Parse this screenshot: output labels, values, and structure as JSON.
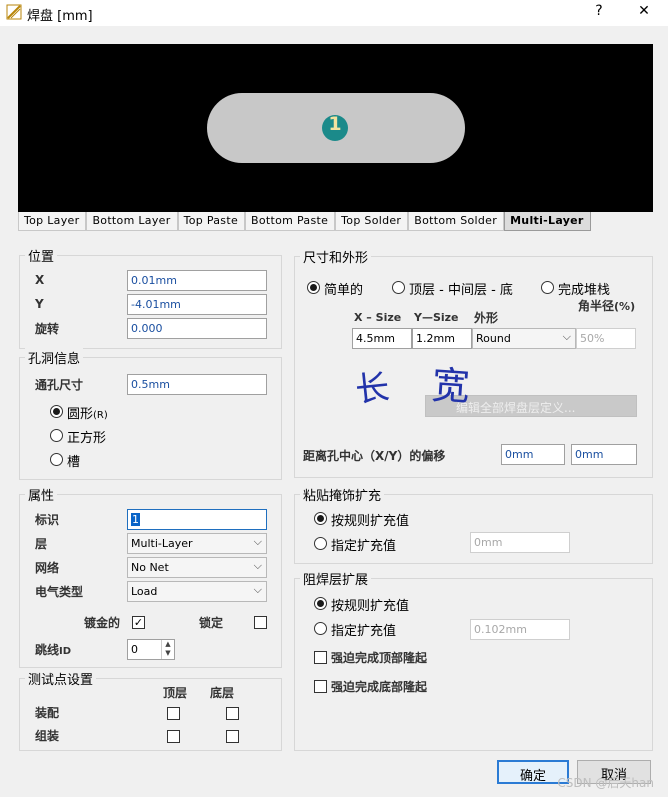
{
  "window": {
    "title": "焊盘 [mm]",
    "help": "?",
    "close": "✕"
  },
  "preview": {
    "pad_number": "1"
  },
  "tabs": [
    "Top Layer",
    "Bottom Layer",
    "Top Paste",
    "Bottom Paste",
    "Top Solder",
    "Bottom Solder",
    "Multi-Layer"
  ],
  "location": {
    "title": "位置",
    "x_label": "X",
    "x_value": "0.01mm",
    "y_label": "Y",
    "y_value": "-4.01mm",
    "rot_label": "旋转",
    "rot_value": "0.000"
  },
  "hole": {
    "title": "孔洞信息",
    "size_label": "通孔尺寸",
    "size_value": "0.5mm",
    "round": "圆形",
    "round_suffix": "(R)",
    "square": "正方形",
    "slot": "槽"
  },
  "properties": {
    "title": "属性",
    "designator_label": "标识",
    "designator_value": "1",
    "layer_label": "层",
    "layer_value": "Multi-Layer",
    "net_label": "网络",
    "net_value": "No Net",
    "etype_label": "电气类型",
    "etype_value": "Load",
    "plated_label": "镀金的",
    "plated_mark": "✓",
    "locked_label": "锁定",
    "jumper_label": "跳线",
    "jumper_suffix": "ID",
    "jumper_value": "0"
  },
  "testpoint": {
    "title": "测试点设置",
    "top": "顶层",
    "bottom": "底层",
    "assembly": "装配",
    "fab": "组装"
  },
  "size_shape": {
    "title": "尺寸和外形",
    "simple": "简单的",
    "top_mid_bot": "顶层 - 中间层 - 底",
    "full_stack": "完成堆栈",
    "xsize_hdr": "X – Size",
    "ysize_hdr": "Y—Size",
    "shape_hdr": "外形",
    "corner_hdr": "角半径",
    "corner_unit": "(%)",
    "xsize": "4.5mm",
    "ysize": "1.2mm",
    "shape": "Round",
    "corner": "50%",
    "hand_long": "长",
    "hand_wide": "宽",
    "edit_btn": "编辑全部焊盘层定义...",
    "offset_label": "距离孔中心（X/Y）的偏移",
    "offset_x": "0mm",
    "offset_y": "0mm"
  },
  "paste": {
    "title": "粘贴掩饰扩充",
    "by_rule": "按规则扩充值",
    "specify": "指定扩充值",
    "value": "0mm"
  },
  "solder": {
    "title": "阻焊层扩展",
    "by_rule": "按规则扩充值",
    "specify": "指定扩充值",
    "value": "0.102mm",
    "force_top": "强迫完成顶部隆起",
    "force_bottom": "强迫完成底部隆起"
  },
  "footer": {
    "ok": "确定",
    "cancel": "取消",
    "watermark": "CSDN @后天han"
  }
}
